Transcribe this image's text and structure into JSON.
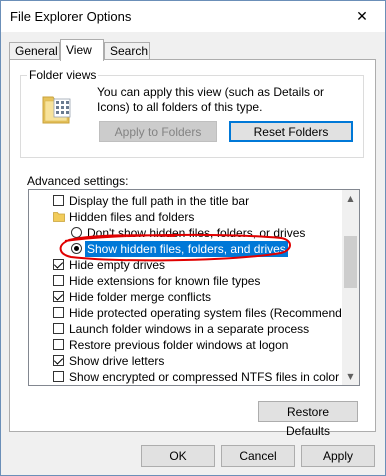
{
  "window": {
    "title": "File Explorer Options",
    "close_glyph": "✕"
  },
  "tabs": [
    {
      "label": "General"
    },
    {
      "label": "View"
    },
    {
      "label": "Search"
    }
  ],
  "folder_views": {
    "group_label": "Folder views",
    "description": "You can apply this view (such as Details or Icons) to all folders of this type.",
    "apply_label": "Apply to Folders",
    "reset_label": "Reset Folders"
  },
  "advanced": {
    "label": "Advanced settings:",
    "items": [
      {
        "type": "checkbox",
        "checked": false,
        "label": "Display the full path in the title bar"
      },
      {
        "type": "folder",
        "label": "Hidden files and folders"
      },
      {
        "type": "radio",
        "checked": false,
        "label": "Don't show hidden files, folders, or drives"
      },
      {
        "type": "radio",
        "checked": true,
        "label": "Show hidden files, folders, and drives"
      },
      {
        "type": "checkbox",
        "checked": true,
        "label": "Hide empty drives"
      },
      {
        "type": "checkbox",
        "checked": false,
        "label": "Hide extensions for known file types"
      },
      {
        "type": "checkbox",
        "checked": true,
        "label": "Hide folder merge conflicts"
      },
      {
        "type": "checkbox",
        "checked": false,
        "label": "Hide protected operating system files (Recommended)"
      },
      {
        "type": "checkbox",
        "checked": false,
        "label": "Launch folder windows in a separate process"
      },
      {
        "type": "checkbox",
        "checked": false,
        "label": "Restore previous folder windows at logon"
      },
      {
        "type": "checkbox",
        "checked": true,
        "label": "Show drive letters"
      },
      {
        "type": "checkbox",
        "checked": false,
        "label": "Show encrypted or compressed NTFS files in color"
      }
    ]
  },
  "restore_defaults_label": "Restore Defaults",
  "footer": {
    "ok": "OK",
    "cancel": "Cancel",
    "apply": "Apply"
  },
  "colors": {
    "selection": "#0078d7",
    "annotation": "#e00000"
  }
}
